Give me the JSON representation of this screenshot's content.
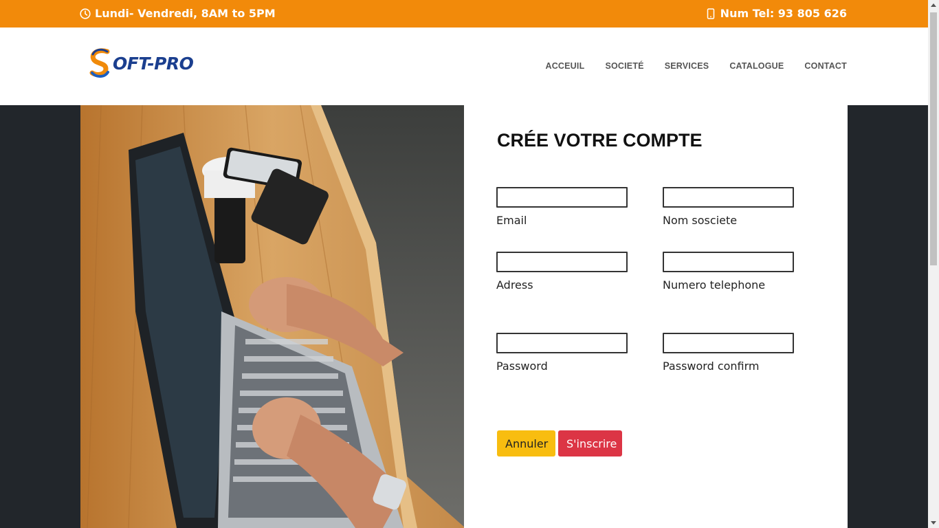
{
  "topbar": {
    "hours": "Lundi- Vendredi, 8AM to 5PM",
    "phone": "Num Tel: 93 805 626",
    "hours_icon": "clock-icon",
    "phone_icon": "mobile-phone-icon",
    "background": "#f28a0a"
  },
  "header": {
    "logo_text": "OFT-PRO",
    "nav": [
      "ACCEUIL",
      "SOCIETÉ",
      "SERVICES",
      "CATALOGUE",
      "CONTACT"
    ]
  },
  "form": {
    "title": "CRÉE VOTRE COMPTE",
    "fields": {
      "email": {
        "label": "Email",
        "value": ""
      },
      "company": {
        "label": "Nom sosciete",
        "value": ""
      },
      "address": {
        "label": "Adress",
        "value": ""
      },
      "phone": {
        "label": "Numero telephone",
        "value": ""
      },
      "password": {
        "label": "Password",
        "value": ""
      },
      "password_confirm": {
        "label": "Password confirm",
        "value": ""
      }
    },
    "buttons": {
      "cancel": "Annuler",
      "submit": "S'inscrire"
    }
  },
  "colors": {
    "accent": "#f28a0a",
    "cancel_button": "#f8bd10",
    "submit_button": "#dc3545",
    "page_background": "#22262b"
  }
}
